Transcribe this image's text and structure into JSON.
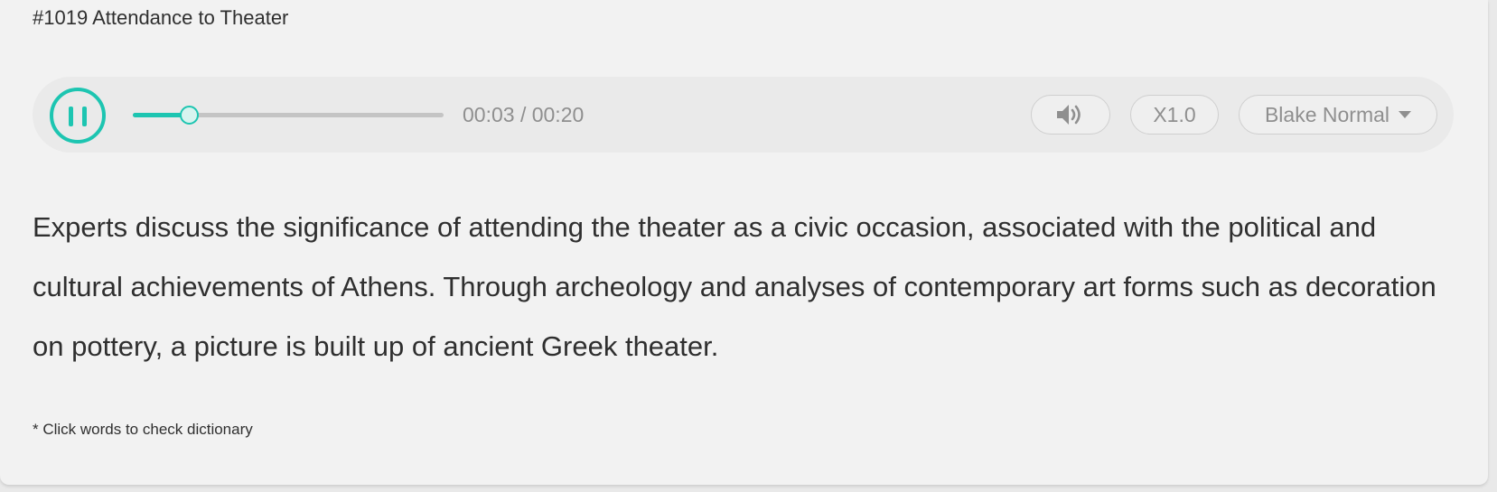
{
  "lesson": {
    "title": "#1019 Attendance to Theater"
  },
  "player": {
    "state": "playing",
    "pause_icon": "pause-icon",
    "progress": 0.18,
    "time_display": "00:03 / 00:20",
    "volume_icon": "speaker-icon",
    "speed_label": "X1.0",
    "voice_label": "Blake Normal",
    "voice_dropdown_icon": "caret-down-icon",
    "accent_color": "#1dc5b1"
  },
  "transcript": {
    "text": "Experts discuss the significance of attending the theater as a civic occasion, associated with the political and cultural achievements of Athens. Through archeology and analyses of contemporary art forms such as decoration on pottery, a picture is built up of ancient Greek theater."
  },
  "footer": {
    "hint": "* Click words to check dictionary"
  }
}
